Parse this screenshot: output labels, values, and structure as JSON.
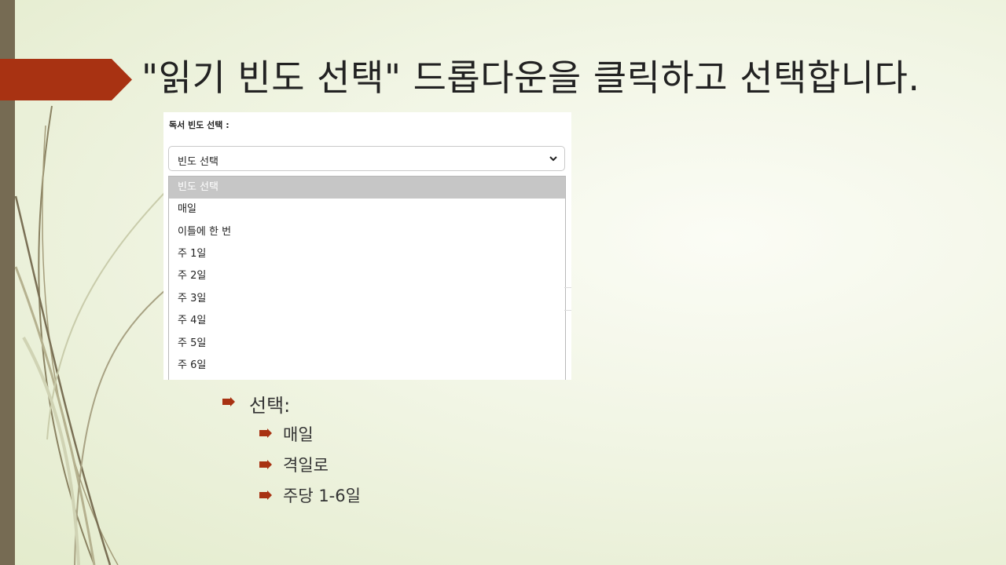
{
  "slide": {
    "title": "\"읽기 빈도 선택\" 드롭다운을 클릭하고 선택합니다.",
    "accent_color": "#a83212",
    "sidebar_color": "#766b53"
  },
  "screenshot": {
    "label": "독서 빈도 선택 :",
    "select_value": "빈도 선택",
    "options": [
      {
        "label": "빈도 선택",
        "selected": true
      },
      {
        "label": "매일",
        "selected": false
      },
      {
        "label": "이틀에 한 번",
        "selected": false
      },
      {
        "label": "주 1일",
        "selected": false
      },
      {
        "label": "주 2일",
        "selected": false
      },
      {
        "label": "주 3일",
        "selected": false
      },
      {
        "label": "주 4일",
        "selected": false
      },
      {
        "label": "주 5일",
        "selected": false
      },
      {
        "label": "주 6일",
        "selected": false
      }
    ]
  },
  "bullets": {
    "heading": "선택:",
    "items": [
      "매일",
      "격일로",
      "주당 1-6일"
    ],
    "bullet_icon": "arrow-bullet-icon"
  }
}
